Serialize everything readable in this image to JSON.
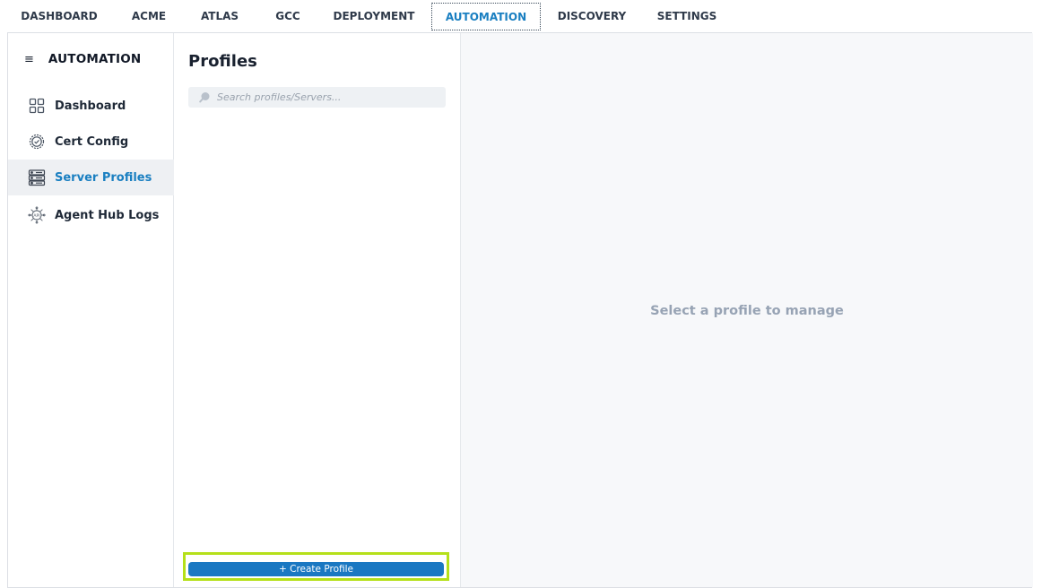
{
  "top_tabs": [
    {
      "label": "DASHBOARD"
    },
    {
      "label": "ACME"
    },
    {
      "label": "ATLAS"
    },
    {
      "label": "GCC"
    },
    {
      "label": "DEPLOYMENT"
    },
    {
      "label": "AUTOMATION",
      "active": true
    },
    {
      "label": "DISCOVERY"
    },
    {
      "label": "SETTINGS"
    }
  ],
  "sidebar": {
    "title": "AUTOMATION",
    "items": [
      {
        "label": "Dashboard",
        "icon": "grid-icon"
      },
      {
        "label": "Cert Config",
        "icon": "gear-icon"
      },
      {
        "label": "Server Profiles",
        "icon": "server-icon",
        "active": true
      },
      {
        "label": "Agent Hub Logs",
        "icon": "api-icon"
      }
    ]
  },
  "profiles": {
    "title": "Profiles",
    "search_placeholder": "Search profiles/Servers...",
    "search_value": "",
    "create_label": "+ Create Profile"
  },
  "detail": {
    "empty_message": "Select a profile to manage"
  },
  "colors": {
    "accent": "#1a7fc1",
    "highlight": "#b5e01a",
    "muted_text": "#97a3b4"
  }
}
